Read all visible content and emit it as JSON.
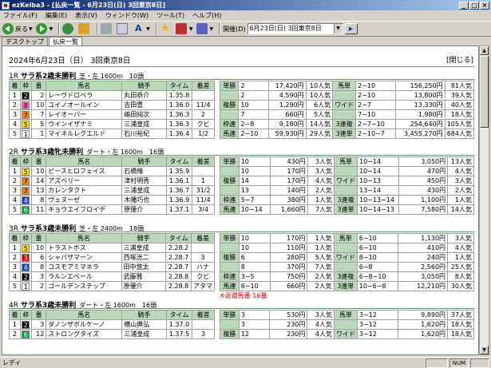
{
  "window": {
    "title": "ezKeiba3 - [払戻一覧 - 6月23日(日) 3回東京8日]"
  },
  "menu": [
    "ファイル(F)",
    "編集(E)",
    "表示(V)",
    "ウィンドウ(W)",
    "ツール(T)",
    "ヘルプ(H)"
  ],
  "toolbar": {
    "back": "戻る",
    "forward": "",
    "date_label": "開催(D)",
    "date_value": "6月23日(日) 3回東京8日"
  },
  "tabs": [
    "デスクトップ",
    "払戻一覧"
  ],
  "page": {
    "heading": "2024年6月23日（日） 3回東京8日",
    "close": "[閉じる]"
  },
  "races": [
    {
      "no": "1R",
      "name": "サラ系2歳未勝利",
      "info": "芝・左 1600m　10頭",
      "headers": [
        "着",
        "枠",
        "番",
        "馬名",
        "騎手",
        "タイム",
        "着差"
      ],
      "rows": [
        [
          "1",
          "2",
          "2",
          "レーヴドロペラ",
          "丸田恭介",
          "1.35.8",
          ""
        ],
        [
          "2",
          "8",
          "10",
          "ユイノオールイン",
          "吉田豊",
          "1.36.0",
          "11/4"
        ],
        [
          "3",
          "7",
          "7",
          "レイオーバー",
          "嶋田純次",
          "1.36.3",
          "2"
        ],
        [
          "4",
          "5",
          "5",
          "ウインイザナミ",
          "三浦皇成",
          "1.36.3",
          "クビ"
        ],
        [
          "5",
          "1",
          "1",
          "マイネルレクエルド",
          "石川裕紀",
          "1.36.4",
          "1/2"
        ]
      ],
      "payouts": [
        [
          "単勝",
          "2",
          "17,420円",
          "10人気",
          "馬単",
          "2−10",
          "156,250円",
          "81人気"
        ],
        [
          "",
          "2",
          "4,590円",
          "10人気",
          "",
          "2−10",
          "13,800円",
          "39人気"
        ],
        [
          "複勝",
          "10",
          "1,290円",
          "6人気",
          "ワイド",
          "2−7",
          "13,330円",
          "40人気"
        ],
        [
          "",
          "7",
          "660円",
          "5人気",
          "",
          "7−10",
          "1,980円",
          "18人気"
        ],
        [
          "枠連",
          "2−8",
          "9,180円",
          "14人気",
          "3連複",
          "2−7−10",
          "254,640円",
          "105人気"
        ],
        [
          "馬連",
          "2−10",
          "59,930円",
          "29人気",
          "3連単",
          "2−10−7",
          "3,455,270円",
          "684人気"
        ]
      ],
      "note": ""
    },
    {
      "no": "2R",
      "name": "サラ系3歳牝未勝利",
      "info": "ダート・左 1600m　16頭",
      "headers": [
        "着",
        "枠",
        "番",
        "馬名",
        "騎手",
        "タイム",
        "着差"
      ],
      "rows": [
        [
          "1",
          "5",
          "10",
          "ピースヒロフェイス",
          "石橋脩",
          "1.35.9",
          ""
        ],
        [
          "2",
          "7",
          "14",
          "アズベリー",
          "津村明秀",
          "1.36.1",
          "1"
        ],
        [
          "3",
          "7",
          "13",
          "カレンタクト",
          "三浦皇成",
          "1.36.7",
          "31/2"
        ],
        [
          "4",
          "4",
          "8",
          "ヴェヌーゼ",
          "木幡巧也",
          "1.36.9",
          "11/4"
        ],
        [
          "5",
          "6",
          "11",
          "キョウエイフロイデ",
          "原優介",
          "1.37.1",
          "3/4"
        ]
      ],
      "payouts": [
        [
          "単勝",
          "10",
          "430円",
          "3人気",
          "馬単",
          "10−14",
          "3,050円",
          "13人気"
        ],
        [
          "",
          "10",
          "170円",
          "3人気",
          "",
          "10−14",
          "470円",
          "4人気"
        ],
        [
          "複勝",
          "14",
          "170円",
          "4人気",
          "ワイド",
          "10−13",
          "450円",
          "3人気"
        ],
        [
          "",
          "13",
          "140円",
          "2人気",
          "",
          "13−14",
          "430円",
          "2人気"
        ],
        [
          "枠連",
          "5−7",
          "380円",
          "1人気",
          "3連複",
          "10−13−14",
          "1,100円",
          "1人気"
        ],
        [
          "馬連",
          "10−14",
          "1,660円",
          "7人気",
          "3連単",
          "10−14−13",
          "7,580円",
          "14人気"
        ]
      ],
      "note": ""
    },
    {
      "no": "3R",
      "name": "サラ系3歳未勝利",
      "info": "芝・左 2400m　18頭",
      "headers": [
        "着",
        "枠",
        "番",
        "馬名",
        "騎手",
        "タイム",
        "着差"
      ],
      "rows": [
        [
          "1",
          "5",
          "10",
          "トラストボス",
          "三浦皇成",
          "2.28.2",
          ""
        ],
        [
          "2",
          "3",
          "6",
          "シャバザマーン",
          "西塚洸二",
          "2.28.7",
          "3"
        ],
        [
          "3",
          "4",
          "8",
          "コスモアミマネラ",
          "田中悠太",
          "2.28.7",
          "ハナ"
        ],
        [
          "4",
          "2",
          "3",
          "ラルンエベール",
          "武藤雅",
          "2.28.8",
          "クビ"
        ],
        [
          "5",
          "1",
          "2",
          "ゴールデンステップ",
          "原優介",
          "2.28.8",
          "アタマ"
        ]
      ],
      "payouts": [
        [
          "単勝",
          "10",
          "170円",
          "1人気",
          "馬単",
          "6−10",
          "1,130円",
          "3人気"
        ],
        [
          "",
          "10",
          "110円",
          "1人気",
          "",
          "6−10",
          "410円",
          "4人気"
        ],
        [
          "複勝",
          "6",
          "280円",
          "5人気",
          "ワイド",
          "8−10",
          "240円",
          "1人気"
        ],
        [
          "",
          "8",
          "370円",
          "7人気",
          "",
          "6−8",
          "2,560円",
          "25人気"
        ],
        [
          "枠連",
          "3−5",
          "750円",
          "2人気",
          "3連複",
          "6−8−10",
          "3,050円",
          "8人気"
        ],
        [
          "馬連",
          "6−10",
          "660円",
          "2人気",
          "3連単",
          "10−6−8",
          "12,210円",
          "30人気"
        ]
      ],
      "note": "※返還馬番 16番"
    },
    {
      "no": "4R",
      "name": "サラ系3歳未勝利",
      "info": "ダート・左 1600m　16頭",
      "headers": [
        "着",
        "枠",
        "番",
        "馬名",
        "騎手",
        "タイム",
        "着差"
      ],
      "rows": [
        [
          "1",
          "2",
          "3",
          "ダノンザボルケーノ",
          "横山典弘",
          "1.37.0",
          ""
        ],
        [
          "2",
          "6",
          "12",
          "ストロングタイズ",
          "三浦皇成",
          "1.37.5",
          "3"
        ]
      ],
      "payouts": [
        [
          "単勝",
          "3",
          "530円",
          "3人気",
          "馬単",
          "3−12",
          "9,890円",
          "37人気"
        ],
        [
          "",
          "3",
          "230円",
          "4人気",
          "",
          "3−12",
          "1,620円",
          "18人気"
        ],
        [
          "複勝",
          "12",
          "230円",
          "4人気",
          "ワイド",
          "3−12",
          "1,620円",
          "18人気"
        ]
      ],
      "note": ""
    }
  ],
  "waku_colors": {
    "1": [
      "#ffffff",
      "#000000"
    ],
    "2": [
      "#000000",
      "#ffffff"
    ],
    "3": [
      "#e00000",
      "#ffffff"
    ],
    "4": [
      "#1040e0",
      "#ffffff"
    ],
    "5": [
      "#ffe000",
      "#000000"
    ],
    "6": [
      "#00a040",
      "#ffffff"
    ],
    "7": [
      "#ff8000",
      "#000000"
    ],
    "8": [
      "#ff60c0",
      "#000000"
    ]
  },
  "status": {
    "text": "レディ",
    "num": "NUM"
  }
}
